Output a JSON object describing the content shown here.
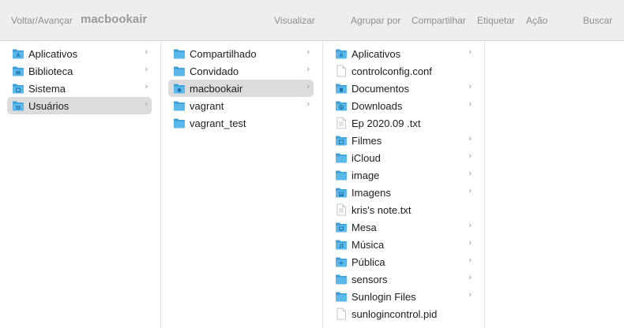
{
  "toolbar": {
    "back_forward": "Voltar/Avançar",
    "title": "macbookair",
    "view": "Visualizar",
    "group": "Agrupar por",
    "share": "Compartilhar",
    "tag": "Etiquetar",
    "action": "Ação",
    "search": "Buscar"
  },
  "column1": [
    {
      "label": "Aplicativos",
      "icon": "apps-folder-icon",
      "chevron": "›"
    },
    {
      "label": "Biblioteca",
      "icon": "library-folder-icon",
      "chevron": "›"
    },
    {
      "label": "Sistema",
      "icon": "system-folder-icon",
      "chevron": "›"
    },
    {
      "label": "Usuários",
      "icon": "users-folder-icon",
      "chevron": "›",
      "selected": true
    }
  ],
  "column2": [
    {
      "label": "Compartilhado",
      "icon": "folder-icon",
      "chevron": "›"
    },
    {
      "label": "Convidado",
      "icon": "folder-icon",
      "chevron": "›"
    },
    {
      "label": "macbookair",
      "icon": "home-folder-icon",
      "chevron": "›",
      "selected": true
    },
    {
      "label": "vagrant",
      "icon": "folder-icon",
      "chevron": "›"
    },
    {
      "label": "vagrant_test",
      "icon": "folder-icon",
      "chevron": ""
    }
  ],
  "column3": [
    {
      "label": "Aplicativos",
      "icon": "apps-folder-icon",
      "chevron": "›"
    },
    {
      "label": "controlconfig.conf",
      "icon": "document-icon",
      "chevron": ""
    },
    {
      "label": "Documentos",
      "icon": "documents-folder-icon",
      "chevron": "›"
    },
    {
      "label": "Downloads",
      "icon": "downloads-folder-icon",
      "chevron": "›"
    },
    {
      "label": "Ep 2020.09  .txt",
      "icon": "text-file-icon",
      "chevron": ""
    },
    {
      "label": "Filmes",
      "icon": "movies-folder-icon",
      "chevron": "›"
    },
    {
      "label": "iCloud",
      "icon": "folder-icon",
      "chevron": "›"
    },
    {
      "label": "image",
      "icon": "folder-icon",
      "chevron": "›"
    },
    {
      "label": "Imagens",
      "icon": "pictures-folder-icon",
      "chevron": "›"
    },
    {
      "label": "kris's note.txt",
      "icon": "text-file-icon",
      "chevron": ""
    },
    {
      "label": "Mesa",
      "icon": "desktop-folder-icon",
      "chevron": "›"
    },
    {
      "label": "Música",
      "icon": "music-folder-icon",
      "chevron": "›"
    },
    {
      "label": "Pública",
      "icon": "public-folder-icon",
      "chevron": "›"
    },
    {
      "label": "sensors",
      "icon": "folder-icon",
      "chevron": "›"
    },
    {
      "label": "Sunlogin Files",
      "icon": "folder-icon",
      "chevron": "›"
    },
    {
      "label": "sunlogincontrol.pid",
      "icon": "document-icon",
      "chevron": ""
    }
  ],
  "colors": {
    "folder": "#5ab8ea",
    "folder_tab": "#3d9fd9",
    "selection": "#dcdcdc",
    "toolbar_bg": "#efeeed"
  }
}
